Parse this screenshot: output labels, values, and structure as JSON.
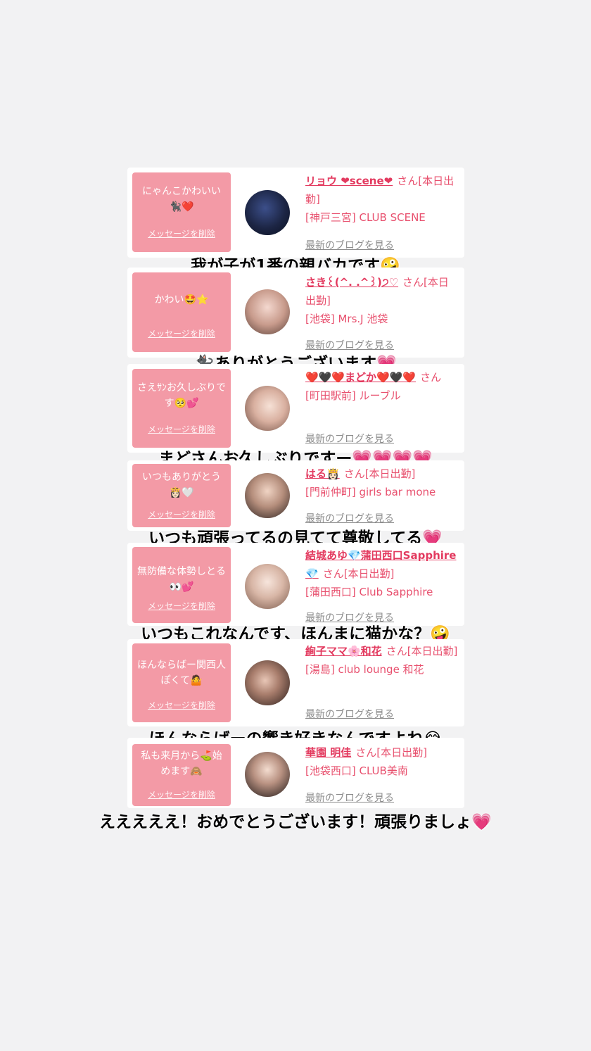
{
  "items": [
    {
      "message": "にゃんこかわいい🐈‍⬛❤️",
      "delete_label": "メッセージを削除",
      "name": "リョウ ❤scene❤",
      "san": "さん[本日出勤]",
      "shop": "[神戸三宮] CLUB SCENE",
      "blog_label": "最新のブログを見る",
      "caption": "我が子が1番の親バカです🤪"
    },
    {
      "message": "かわい🤩⭐️",
      "delete_label": "メッセージを削除",
      "name": "さき꒰(^. .^꒱)੭♡",
      "san": "さん[本日出勤]",
      "shop": "[池袋] Mrs.J 池袋",
      "blog_label": "最新のブログを見る",
      "caption": "🐈‍⬛ありがとうございます💗"
    },
    {
      "message": "さえｻﾝお久しぶりです🥺💕",
      "delete_label": "メッセージを削除",
      "name": "❤️🖤❤️まどか❤️🖤❤️",
      "san": "さん",
      "shop": "[町田駅前] ルーブル",
      "blog_label": "最新のブログを見る",
      "caption": "まどさんお久しぶりですー💗💗💗💗"
    },
    {
      "message": "いつもありがとう👸🏻🤍",
      "delete_label": "メッセージを削除",
      "name": "はる👸🏻",
      "san": "さん[本日出勤]",
      "shop": "[門前仲町] girls bar mone",
      "blog_label": "最新のブログを見る",
      "caption": "いつも頑張ってるの見てて尊敬してる💗"
    },
    {
      "message": "無防備な体勢しとる👀💕",
      "delete_label": "メッセージを削除",
      "name": "結城あゆ💎蒲田西口Sapphire💎",
      "san": "さん[本日出勤]",
      "shop": "[蒲田西口] Club Sapphire",
      "blog_label": "最新のブログを見る",
      "caption": "いつもこれなんです、ほんまに猫かな？🤪"
    },
    {
      "message": "ほんならばー関西人ぽくて🤷",
      "delete_label": "メッセージを削除",
      "name": "絢子ママ🌸和花",
      "san": "さん[本日出勤]",
      "shop": "[湯島] club lounge 和花",
      "blog_label": "最新のブログを見る",
      "caption": "ほんならばーの響き好きなんですよね😂"
    },
    {
      "message": "私も来月から⛳️始めます🙈",
      "delete_label": "メッセージを削除",
      "name": "華園 明佳",
      "san": "さん[本日出勤]",
      "shop": "[池袋西口] CLUB美南",
      "blog_label": "最新のブログを見る",
      "caption": "えええええ！おめでとうございます！頑張りましょ💗"
    }
  ]
}
